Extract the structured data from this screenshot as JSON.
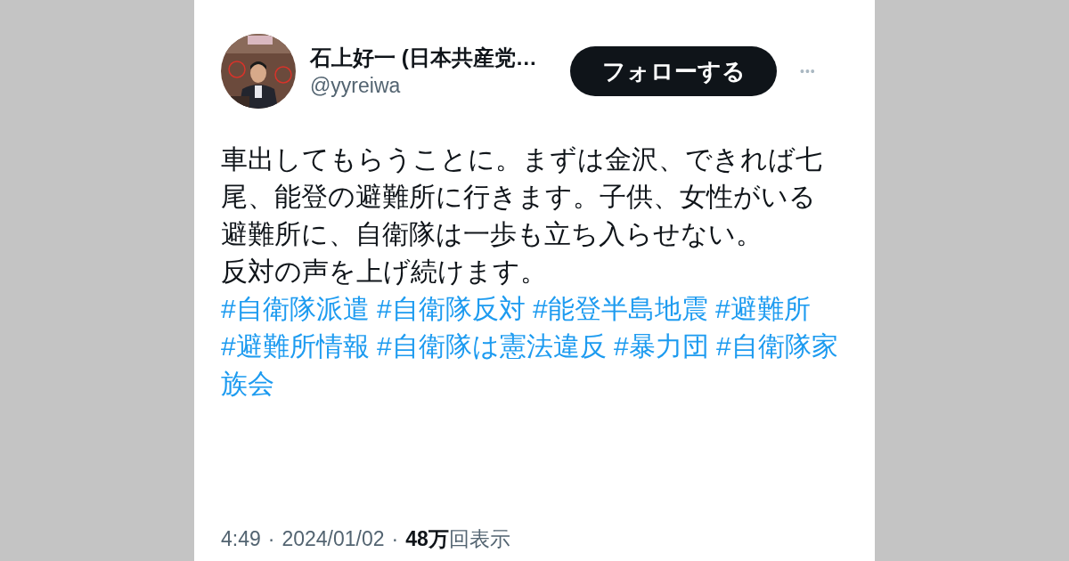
{
  "author": {
    "name": "石上好一 (日本共産党…",
    "handle": "@yyreiwa"
  },
  "follow_button": "フォローする",
  "more_button": "•••",
  "body_lines": [
    "車出してもらうことに。まずは金沢、できれば七",
    "尾、能登の避難所に行きます。子供、女性がいる",
    "避難所に、自衛隊は一歩も立ち入らせない。",
    "反対の声を上げ続けます。"
  ],
  "hashtags": [
    "#自衛隊派遣",
    "#自衛隊反対",
    "#能登半島地震",
    "#避難所",
    "#避難所情報",
    "#自衛隊は憲法違反",
    "#暴力団",
    "#自衛隊家族会"
  ],
  "footer": {
    "time": "4:49",
    "separator_1": "·",
    "date": "2024/01/02",
    "separator_2": "·",
    "views_count": "48万",
    "views_label": "回表示"
  }
}
